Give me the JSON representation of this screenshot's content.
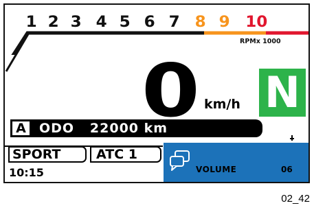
{
  "tachometer": {
    "marks": [
      {
        "label": "1",
        "color": "#111111"
      },
      {
        "label": "2",
        "color": "#111111"
      },
      {
        "label": "3",
        "color": "#111111"
      },
      {
        "label": "4",
        "color": "#111111"
      },
      {
        "label": "5",
        "color": "#111111"
      },
      {
        "label": "6",
        "color": "#111111"
      },
      {
        "label": "7",
        "color": "#111111"
      },
      {
        "label": "8",
        "color": "#f7941d"
      },
      {
        "label": "9",
        "color": "#f7941d"
      },
      {
        "label": "10",
        "color": "#e1162e"
      }
    ],
    "unit": "RPMx 1000"
  },
  "speed": {
    "value": "0",
    "unit": "km/h"
  },
  "gear": {
    "value": "N",
    "color": "#2db34a"
  },
  "odometer": {
    "mode": "A",
    "text": "ODO   22000 km"
  },
  "ride_mode": "SPORT",
  "traction": "ATC 1",
  "clock": "10:15",
  "volume": {
    "label": "VOLUME",
    "value": "06",
    "panel_color": "#1c72b9",
    "icon": "speech-bubbles-icon"
  },
  "caption": "02_42"
}
